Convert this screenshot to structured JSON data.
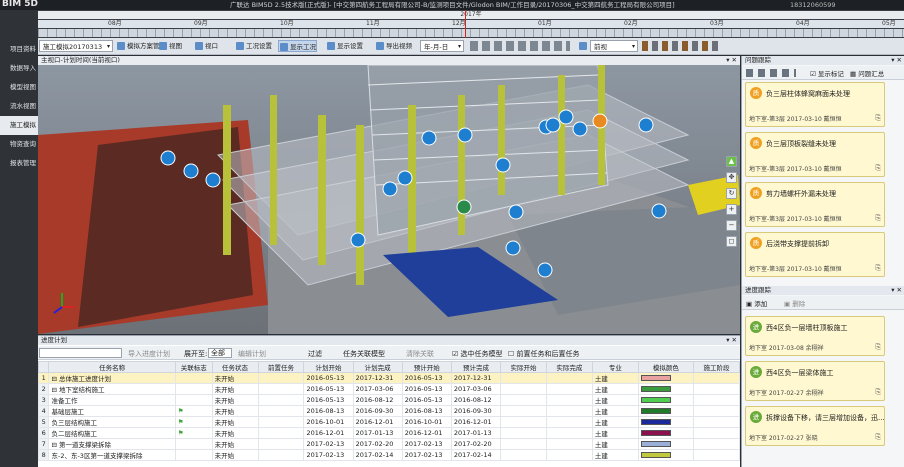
{
  "app": {
    "logo": "BIM 5D",
    "title": "广联达 BIM5D 2.5技术版[正式版]- [中交第四航务工程局有限公司-B/监测项目文件/Glodon BIM/工作目录/20170306_中交第四航务工程局有限公司项目]",
    "phone": "18312060599"
  },
  "timeline": {
    "year": "2017年",
    "months": [
      "08月",
      "09月",
      "10月",
      "11月",
      "12月",
      "01月",
      "02月",
      "03月",
      "04月",
      "05月"
    ]
  },
  "nav": {
    "items": [
      "项目资料",
      "数据导入",
      "模型视图",
      "流水视图",
      "施工模拟",
      "物资查询",
      "报表管理"
    ],
    "active_index": 4
  },
  "toolbar": {
    "plan_select": "施工模拟20170313",
    "btn_plan_mgmt": "模拟方案管理",
    "btn_view": "视图",
    "btn_viewport": "视口",
    "btn_condition": "工况设置",
    "btn_show_condition": "显示工况",
    "btn_display_settings": "显示设置",
    "btn_export_video": "导出视频",
    "date_select": "年-月-日",
    "btn_prev": "◀",
    "btn_forward": "前视"
  },
  "view3d": {
    "title": "主视口-计划时间(当前视口)"
  },
  "issues": {
    "title": "问题跟踪",
    "show_marks": "显示标记",
    "issue_summary": "问题汇总",
    "cards": [
      {
        "badge": "质",
        "text": "负三层柱体蜂窝麻面未处理",
        "meta": "地下室-第3层 2017-03-10 戴恒恒"
      },
      {
        "badge": "质",
        "text": "负三层顶板裂缝未处理",
        "meta": "地下室-第3层 2017-03-10 戴恒恒"
      },
      {
        "badge": "质",
        "text": "剪力墙螺杆外漏未处理",
        "meta": "地下室-第3层 2017-03-10 戴恒恒"
      },
      {
        "badge": "质",
        "text": "后浇带支撑提前拆卸",
        "meta": "地下室-第3层 2017-03-10 戴恒恒"
      }
    ]
  },
  "progress": {
    "title": "进度跟踪",
    "add": "添加",
    "delete": "删除",
    "cards": [
      {
        "badge": "进",
        "text": "西4区负一层墙柱顶板施工",
        "meta": "地下室 2017-03-08 余栩祥"
      },
      {
        "badge": "进",
        "text": "西4区负一层梁体施工",
        "meta": "地下室 2017-02-27 余栩祥"
      },
      {
        "badge": "进",
        "text": "拆撑设备下移，请三层增加设备，迅...",
        "meta": "地下室 2017-02-27 张晓"
      }
    ]
  },
  "tasks": {
    "title": "进度计划",
    "import_btn": "导入进度计划",
    "display_label": "展开至:",
    "display_select": "全部",
    "edit_calc": "编辑计划",
    "filter": "过滤",
    "link_model": "任务关联模型",
    "clear_link": "清除关联",
    "chk_selected": "选中任务模型",
    "chk_prev_next": "前置任务和后置任务",
    "columns": [
      "",
      "任务名称",
      "关联标志",
      "任务状态",
      "前置任务",
      "计划开始",
      "计划完成",
      "预计开始",
      "预计完成",
      "实际开始",
      "实际完成",
      "专业",
      "模拟颜色",
      "施工阶段"
    ],
    "rows": [
      {
        "n": "1",
        "name": "⊟ 总体施工进度计划",
        "flag": "",
        "status": "未开始",
        "pre": "",
        "ps": "2016-05-13",
        "pe": "2017-12-31",
        "es": "2016-05-13",
        "ee": "2017-12-31",
        "as": "",
        "ae": "",
        "major": "土建",
        "color": "#e8a0a0",
        "sel": true
      },
      {
        "n": "2",
        "name": "⊟ 地下室结构施工",
        "flag": "",
        "status": "未开始",
        "pre": "",
        "ps": "2016-05-13",
        "pe": "2017-03-06",
        "es": "2016-05-13",
        "ee": "2017-03-06",
        "as": "",
        "ae": "",
        "major": "土建",
        "color": "#3a9c3a",
        "sel": false
      },
      {
        "n": "3",
        "name": "准备工作",
        "flag": "",
        "status": "未开始",
        "pre": "",
        "ps": "2016-05-13",
        "pe": "2016-08-12",
        "es": "2016-05-13",
        "ee": "2016-08-12",
        "as": "",
        "ae": "",
        "major": "土建",
        "color": "#4fcf4f",
        "sel": false
      },
      {
        "n": "4",
        "name": "基础层施工",
        "flag": "⚑",
        "status": "未开始",
        "pre": "",
        "ps": "2016-08-13",
        "pe": "2016-09-30",
        "es": "2016-08-13",
        "ee": "2016-09-30",
        "as": "",
        "ae": "",
        "major": "土建",
        "color": "#1f7a2a",
        "sel": false
      },
      {
        "n": "5",
        "name": "负三层结构施工",
        "flag": "⚑",
        "status": "未开始",
        "pre": "",
        "ps": "2016-10-01",
        "pe": "2016-12-01",
        "es": "2016-10-01",
        "ee": "2016-12-01",
        "as": "",
        "ae": "",
        "major": "土建",
        "color": "#1a2a9a",
        "sel": false
      },
      {
        "n": "6",
        "name": "负二层结构施工",
        "flag": "⚑",
        "status": "未开始",
        "pre": "",
        "ps": "2016-12-01",
        "pe": "2017-01-13",
        "es": "2016-12-01",
        "ee": "2017-01-13",
        "as": "",
        "ae": "",
        "major": "土建",
        "color": "#8a1050",
        "sel": false
      },
      {
        "n": "7",
        "name": "⊟ 第一道支撑梁拆除",
        "flag": "",
        "status": "未开始",
        "pre": "",
        "ps": "2017-02-13",
        "pe": "2017-02-20",
        "es": "2017-02-13",
        "ee": "2017-02-20",
        "as": "",
        "ae": "",
        "major": "土建",
        "color": "#9ab0d8",
        "sel": false
      },
      {
        "n": "8",
        "name": "东-2、东-3区第一道支撑梁拆除",
        "flag": "",
        "status": "未开始",
        "pre": "",
        "ps": "2017-02-13",
        "pe": "2017-02-14",
        "es": "2017-02-13",
        "ee": "2017-02-14",
        "as": "",
        "ae": "",
        "major": "土建",
        "color": "#c0c840",
        "sel": false
      }
    ]
  }
}
